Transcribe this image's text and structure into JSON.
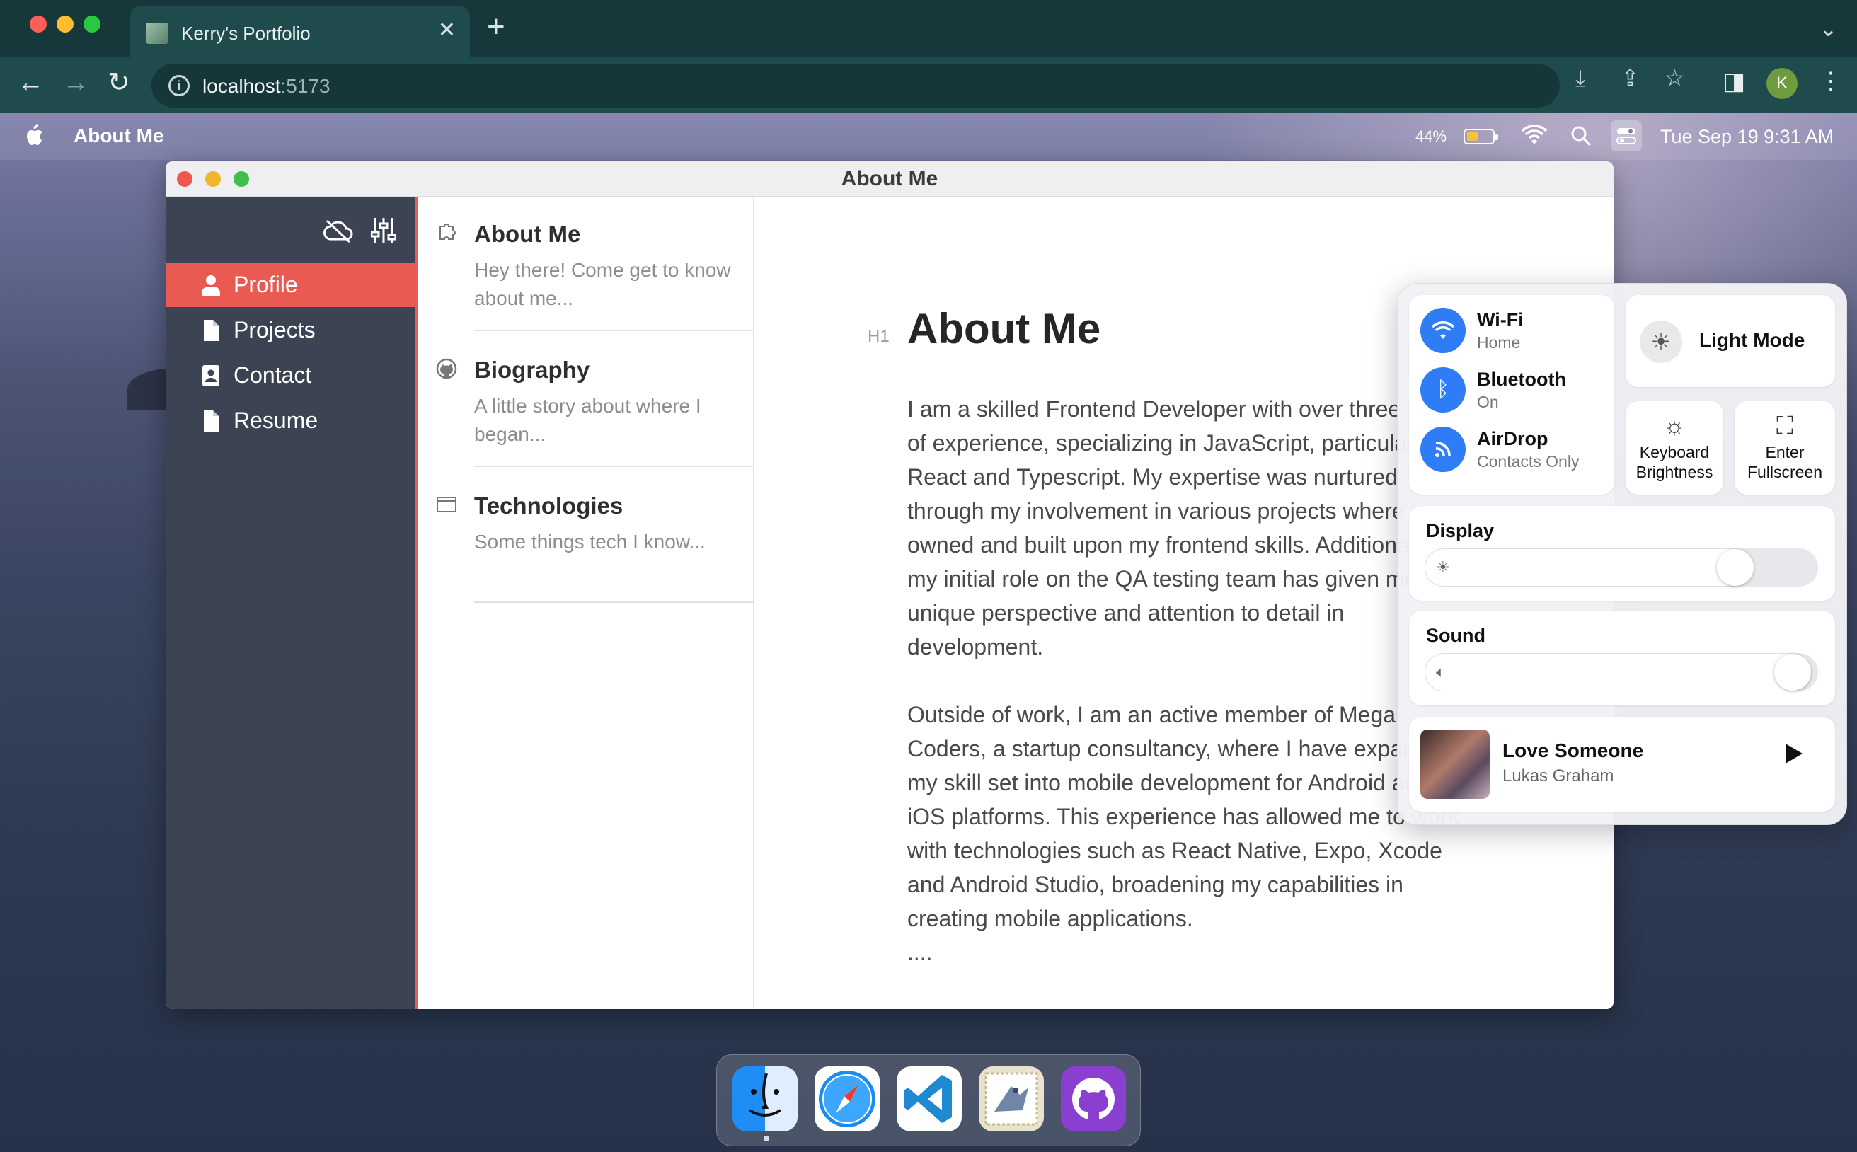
{
  "browser": {
    "tab_title": "Kerry's Portfolio",
    "url_host": "localhost",
    "url_port": ":5173",
    "profile_initial": "K"
  },
  "menubar": {
    "app_name": "About Me",
    "battery_percent": "44%",
    "battery_level": 0.44,
    "clock": "Tue Sep 19  9:31 AM"
  },
  "window": {
    "title": "About Me"
  },
  "sidebar": {
    "items": [
      {
        "label": "Profile",
        "icon": "user-icon",
        "active": true
      },
      {
        "label": "Projects",
        "icon": "file-icon",
        "active": false
      },
      {
        "label": "Contact",
        "icon": "contact-card-icon",
        "active": false
      },
      {
        "label": "Resume",
        "icon": "file-icon",
        "active": false
      }
    ]
  },
  "list": {
    "items": [
      {
        "title": "About Me",
        "description": "Hey there! Come get to know about me...",
        "icon": "puzzle-icon"
      },
      {
        "title": "Biography",
        "description": "A little story about where I began...",
        "icon": "github-icon"
      },
      {
        "title": "Technologies",
        "description": "Some things tech I know...",
        "icon": "browser-window-icon"
      }
    ]
  },
  "content": {
    "heading_tag": "H1",
    "heading": "About Me",
    "paragraph_1": "I am a skilled Frontend Developer with over three years of experience, specializing in JavaScript, particularly React and Typescript. My expertise was nurtured through my involvement in various projects where I owned and built upon my frontend skills. Additionally, my initial role on the QA testing team has given me a unique perspective and attention to detail in development.",
    "paragraph_2": "Outside of work, I am an active member of Mega Coders, a startup consultancy, where I have expanded my skill set into mobile development for Android and iOS platforms. This experience has allowed me to work with technologies such as React Native, Expo, Xcode and Android Studio, broadening my capabilities in creating mobile applications.",
    "ellipsis": "...."
  },
  "control_center": {
    "wifi": {
      "title": "Wi-Fi",
      "subtitle": "Home"
    },
    "bluetooth": {
      "title": "Bluetooth",
      "subtitle": "On"
    },
    "airdrop": {
      "title": "AirDrop",
      "subtitle": "Contacts Only"
    },
    "light_mode": "Light Mode",
    "keyboard_brightness": "Keyboard Brightness",
    "fullscreen": "Enter Fullscreen",
    "display": {
      "label": "Display",
      "level": 0.82
    },
    "sound": {
      "label": "Sound",
      "level": 0.98
    },
    "now_playing": {
      "song": "Love Someone",
      "artist": "Lukas Graham"
    }
  },
  "dock": {
    "apps": [
      "finder-icon",
      "safari-icon",
      "vscode-icon",
      "mail-icon",
      "github-icon"
    ]
  },
  "colors": {
    "accent": "#e95b52",
    "sidebar_bg": "#3c4454",
    "chrome_bg": "#204b4d",
    "cc_blue": "#2f7df6"
  }
}
